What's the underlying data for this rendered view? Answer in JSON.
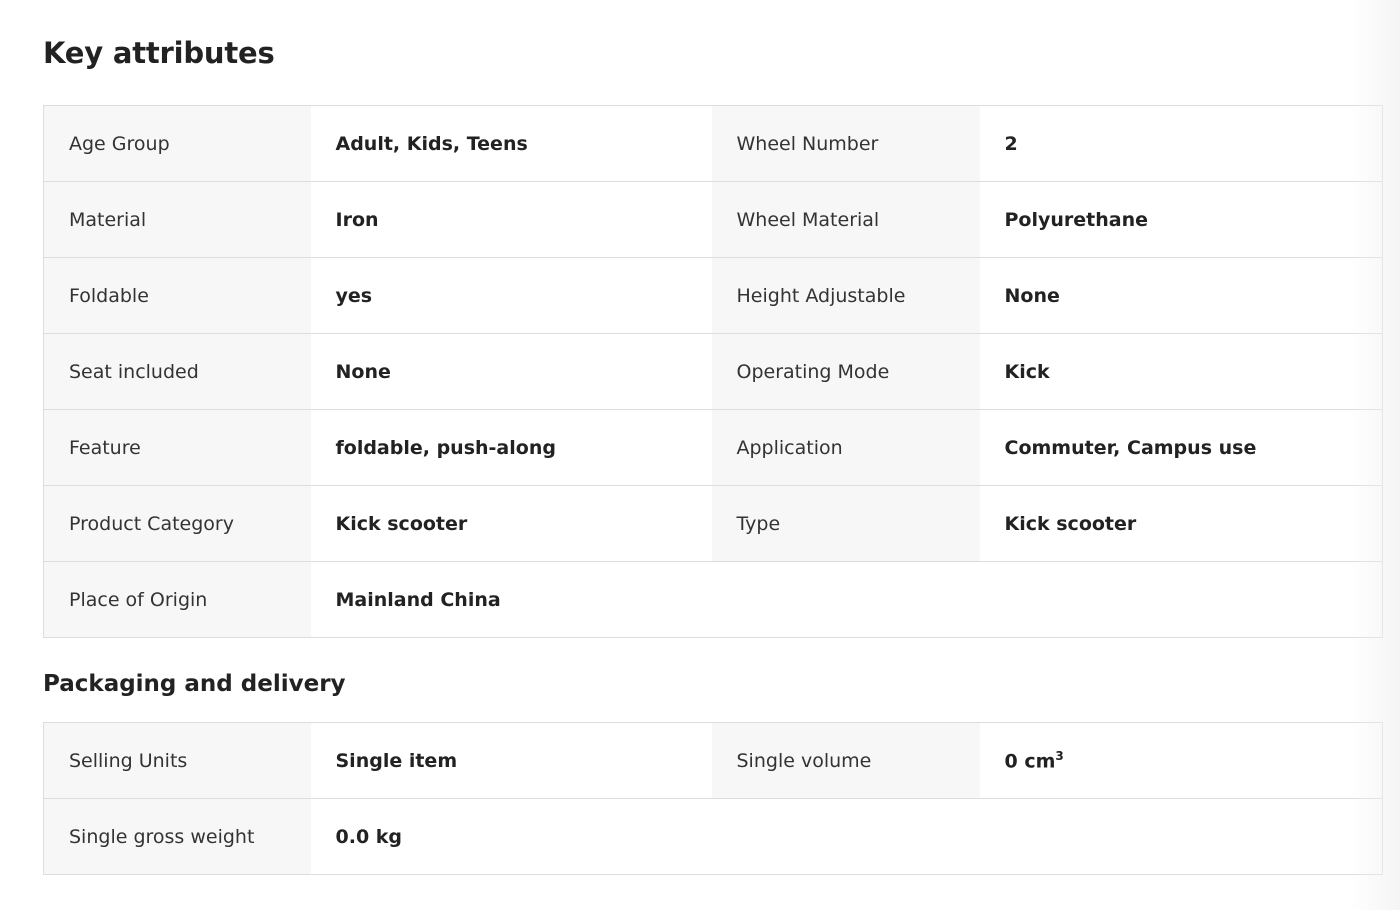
{
  "key_attributes": {
    "title": "Key attributes",
    "rows": [
      {
        "label1": "Age Group",
        "value1": "Adult, Kids, Teens",
        "label2": "Wheel Number",
        "value2": "2"
      },
      {
        "label1": "Material",
        "value1": "Iron",
        "label2": "Wheel Material",
        "value2": "Polyurethane"
      },
      {
        "label1": "Foldable",
        "value1": "yes",
        "label2": "Height Adjustable",
        "value2": "None"
      },
      {
        "label1": "Seat included",
        "value1": "None",
        "label2": "Operating Mode",
        "value2": "Kick"
      },
      {
        "label1": "Feature",
        "value1": "foldable, push-along",
        "label2": "Application",
        "value2": "Commuter, Campus use"
      },
      {
        "label1": "Product Category",
        "value1": "Kick scooter",
        "label2": "Type",
        "value2": "Kick scooter"
      },
      {
        "label1": "Place of Origin",
        "value1": "Mainland China"
      }
    ]
  },
  "packaging": {
    "title": "Packaging and delivery",
    "rows": [
      {
        "label1": "Selling Units",
        "value1": "Single item",
        "label2": "Single volume",
        "value2": "0 cm",
        "value2_sup": "3"
      },
      {
        "label1": "Single gross weight",
        "value1": "0.0 kg"
      }
    ]
  }
}
